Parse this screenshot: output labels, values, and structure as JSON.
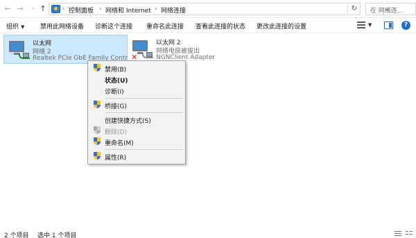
{
  "address_bar": {
    "breadcrumbs": [
      "控制面板",
      "网络和 Internet",
      "网络连接"
    ],
    "search_placeholder": "在 网络连..."
  },
  "command_bar": {
    "items": [
      "组织",
      "禁用此网络设备",
      "诊断这个连接",
      "重命名此连接",
      "查看此连接的状态",
      "更改此连接的设置"
    ]
  },
  "adapters": [
    {
      "name": "以太网",
      "network": "网络 2",
      "device": "Realtek PCIe GbE Family Contr...",
      "selected": true,
      "disconnected": false
    },
    {
      "name": "以太网 2",
      "network": "网络电缆被拔出",
      "device": "NGNClient Adapter",
      "selected": false,
      "disconnected": true
    }
  ],
  "context_menu": {
    "items": [
      {
        "label": "禁用(B)",
        "icon": "uac-shield-icon",
        "bold": false,
        "disabled": false
      },
      {
        "label": "状态(U)",
        "icon": null,
        "bold": true,
        "disabled": false
      },
      {
        "label": "诊断(I)",
        "icon": null,
        "bold": false,
        "disabled": false
      },
      {
        "label": "桥接(G)",
        "icon": "uac-shield-icon",
        "bold": false,
        "disabled": false
      },
      {
        "label": "创建快捷方式(S)",
        "icon": null,
        "bold": false,
        "disabled": false
      },
      {
        "label": "删除(D)",
        "icon": "uac-shield-icon",
        "bold": false,
        "disabled": true
      },
      {
        "label": "重命名(M)",
        "icon": "uac-shield-icon",
        "bold": false,
        "disabled": false
      },
      {
        "label": "属性(R)",
        "icon": "uac-shield-icon",
        "bold": false,
        "disabled": false
      }
    ]
  },
  "status_bar": {
    "item_count": "2 个项目",
    "selected_count": "选中 1 个项目"
  },
  "colors": {
    "selection_fill": "#cce8ff",
    "selection_border": "#99d1ff",
    "help_blue": "#1f6fc5",
    "disconnected_red": "#d01c1c"
  }
}
